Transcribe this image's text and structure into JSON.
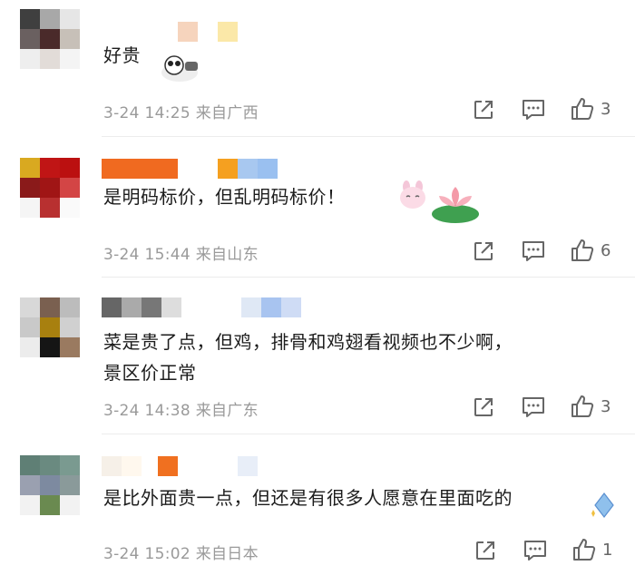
{
  "comments": [
    {
      "text": "好贵",
      "date": "3-24 14:25",
      "location": "来自广西",
      "likes": "3",
      "avatar_colors": [
        "#3f3f3f",
        "#a8a8a8",
        "#e6e6e6",
        "#6a6060",
        "#4a2a2a",
        "#c7c0b8",
        "#eeeeee",
        "#e2dcd8",
        "#f4f4f4"
      ]
    },
    {
      "text": "是明码标价，但乱明码标价！",
      "date": "3-24 15:44",
      "location": "来自山东",
      "likes": "6",
      "avatar_colors": [
        "#d9a920",
        "#c01515",
        "#bb1010",
        "#8a1a1a",
        "#a01515",
        "#d34545",
        "#f5f5f5",
        "#b83030",
        "#fafafa"
      ]
    },
    {
      "text": "菜是贵了点，但鸡，排骨和鸡翅看视频也不少啊，",
      "text2": "景区价正常",
      "date": "3-24 14:38",
      "location": "来自广东",
      "likes": "3",
      "avatar_colors": [
        "#d8d8d8",
        "#7a6050",
        "#bcbcbc",
        "#c9c9c9",
        "#a8800f",
        "#d0d0d0",
        "#ececec",
        "#151515",
        "#9a7a60"
      ]
    },
    {
      "text": "是比外面贵一点，但还是有很多人愿意在里面吃的",
      "date": "3-24 15:02",
      "location": "来自日本",
      "likes": "1",
      "avatar_colors": [
        "#5f7f75",
        "#6a8a80",
        "#7a9a90",
        "#9aa0b0",
        "#7d8aa0",
        "#8a9a9a",
        "#f2f2f2",
        "#6a8a50",
        "#f2f2f2"
      ]
    }
  ],
  "icons": {
    "share": "share-icon",
    "comment": "comment-icon",
    "like": "thumbs-up-icon"
  }
}
